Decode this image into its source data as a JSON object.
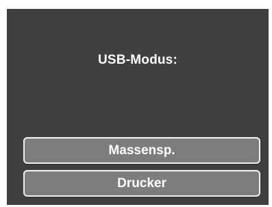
{
  "screen": {
    "title": "USB-Modus:",
    "options": [
      {
        "label": "Massensp."
      },
      {
        "label": "Drucker"
      }
    ]
  },
  "colors": {
    "background": "#404040",
    "button_fill": "#7d7d7d",
    "button_border": "#f2f2f2",
    "text": "#ffffff"
  }
}
